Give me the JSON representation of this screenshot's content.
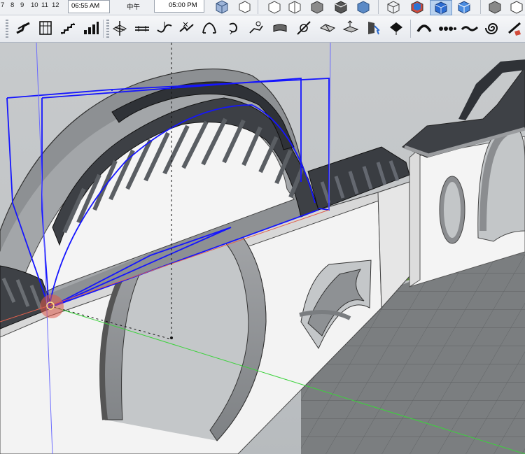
{
  "shadow_bar": {
    "ticks": [
      "7",
      "8",
      "9",
      "10",
      "11",
      "12"
    ],
    "time_current": "06:55 AM",
    "noon_label": "中午",
    "time_end": "05:00 PM"
  },
  "toolbar": {
    "tools": [
      "sandbox-from-contours-icon",
      "wall-tool-icon",
      "stair-tool-icon",
      "bar-graph-icon",
      "sandbox-from-scratch-icon",
      "flat-line-icon",
      "smoove-icon",
      "stamp-icon",
      "drape-icon",
      "add-detail-icon",
      "flip-edge-icon",
      "loft-icon",
      "extrude-icon",
      "soap-skin-icon",
      "push-pull-surface-icon",
      "selection-tool-icon",
      "paint-bucket-icon",
      "arch-tool-icon",
      "bead-icon",
      "wave-icon",
      "spiral-icon",
      "section-plane-icon"
    ]
  },
  "viewport": {
    "colors": {
      "wall_white": "#f3f3f3",
      "stone_gray": "#8e9093",
      "roof_tile": "#3c3f44",
      "selection_blue": "#1515ff",
      "axis_red": "#e0604c",
      "axis_green": "#3cd23c",
      "axis_blue": "#6a6aff"
    }
  }
}
